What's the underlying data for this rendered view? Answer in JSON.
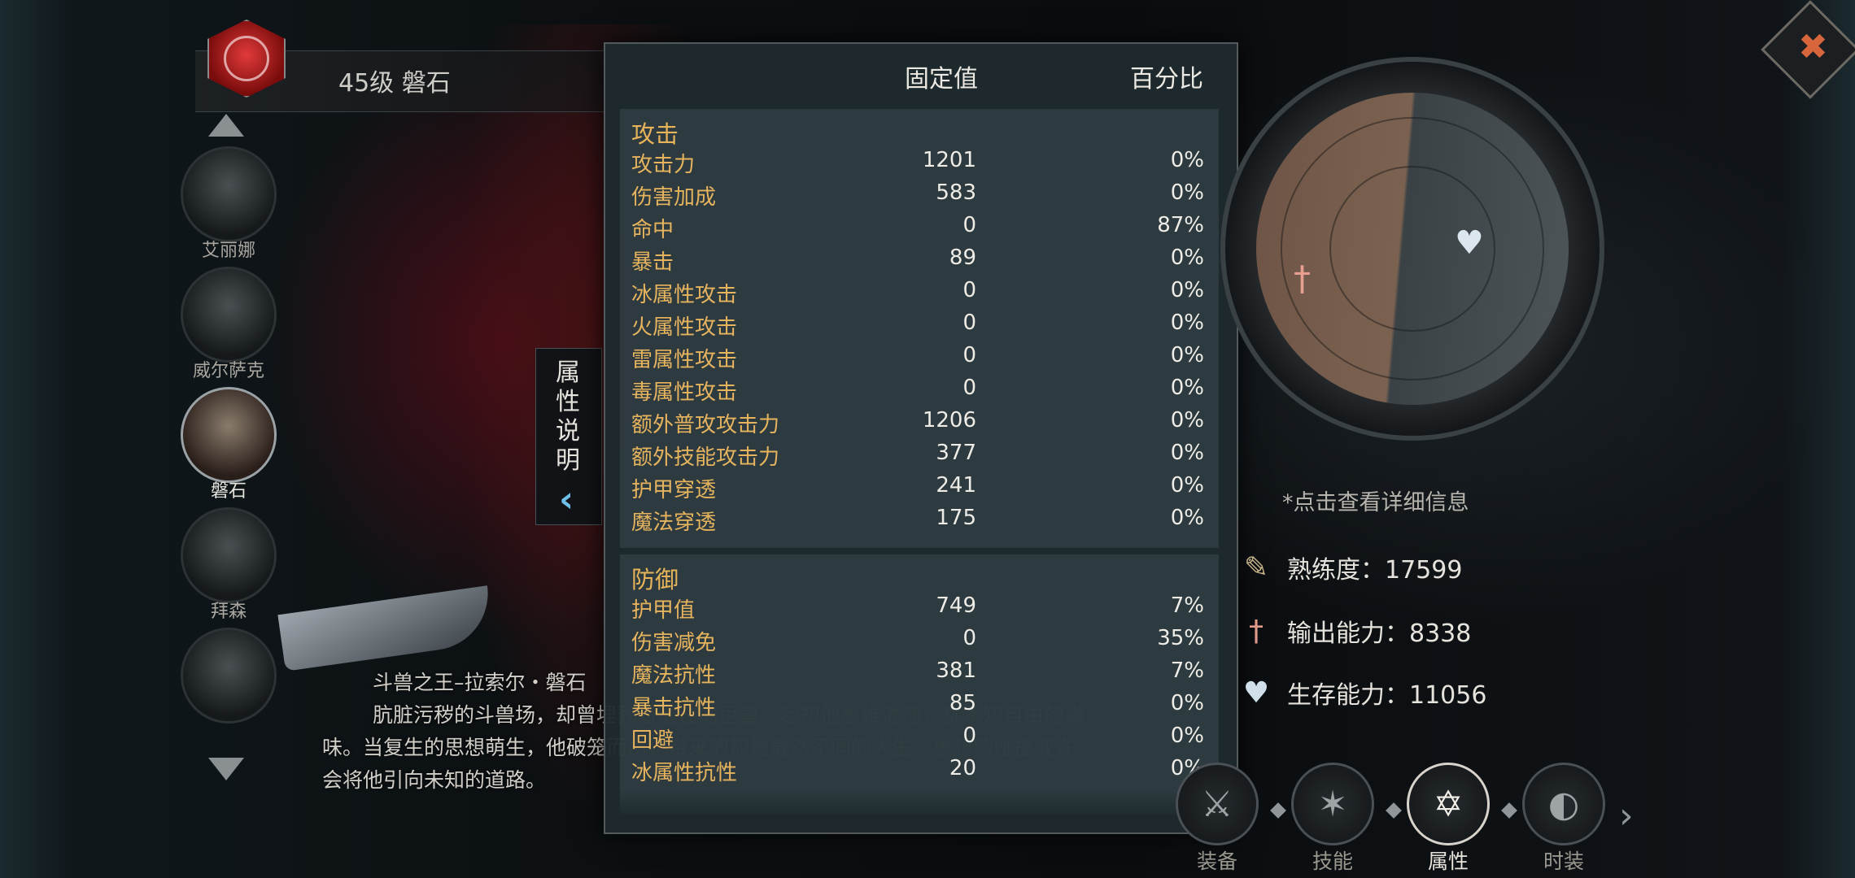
{
  "hero": {
    "title": "45级 磐石"
  },
  "heroes": [
    {
      "name": "艾丽娜"
    },
    {
      "name": "威尔萨克"
    },
    {
      "name": "磐石"
    },
    {
      "name": "拜森"
    },
    {
      "name": ""
    }
  ],
  "attr_tab": {
    "label": "属性说明"
  },
  "description": {
    "title": "斗兽之王–拉索尔・磐石",
    "body": "肮脏污秽的斗兽场，却曾埋葬着潜在的巨兽。起初他思维混沌，犹不知自由的滋味。当复生的思想萌生，他破笼而出，带来的却是截然不同的人生。思想的碰撞或许会将他引向未知的道路。"
  },
  "stats": {
    "col_fixed": "固定值",
    "col_pct": "百分比",
    "attack": {
      "title": "攻击",
      "rows": [
        {
          "name": "攻击力",
          "value": "1201",
          "pct": "0%"
        },
        {
          "name": "伤害加成",
          "value": "583",
          "pct": "0%"
        },
        {
          "name": "命中",
          "value": "0",
          "pct": "87%"
        },
        {
          "name": "暴击",
          "value": "89",
          "pct": "0%"
        },
        {
          "name": "冰属性攻击",
          "value": "0",
          "pct": "0%"
        },
        {
          "name": "火属性攻击",
          "value": "0",
          "pct": "0%"
        },
        {
          "name": "雷属性攻击",
          "value": "0",
          "pct": "0%"
        },
        {
          "name": "毒属性攻击",
          "value": "0",
          "pct": "0%"
        },
        {
          "name": "额外普攻攻击力",
          "value": "1206",
          "pct": "0%"
        },
        {
          "name": "额外技能攻击力",
          "value": "377",
          "pct": "0%"
        },
        {
          "name": "护甲穿透",
          "value": "241",
          "pct": "0%"
        },
        {
          "name": "魔法穿透",
          "value": "175",
          "pct": "0%"
        }
      ]
    },
    "defense": {
      "title": "防御",
      "rows": [
        {
          "name": "护甲值",
          "value": "749",
          "pct": "7%"
        },
        {
          "name": "伤害减免",
          "value": "0",
          "pct": "35%"
        },
        {
          "name": "魔法抗性",
          "value": "381",
          "pct": "7%"
        },
        {
          "name": "暴击抗性",
          "value": "85",
          "pct": "0%"
        },
        {
          "name": "回避",
          "value": "0",
          "pct": "0%"
        },
        {
          "name": "冰属性抗性",
          "value": "20",
          "pct": "0%"
        }
      ]
    }
  },
  "hint": "*点击查看详细信息",
  "metrics": [
    {
      "icon": "proficiency-icon",
      "label": "熟练度：17599"
    },
    {
      "icon": "output-icon",
      "label": "输出能力：8338"
    },
    {
      "icon": "survival-icon",
      "label": "生存能力：11056"
    }
  ],
  "nav": [
    {
      "label": "装备",
      "icon": "equipment-icon"
    },
    {
      "label": "技能",
      "icon": "skill-icon"
    },
    {
      "label": "属性",
      "icon": "attribute-icon",
      "active": true
    },
    {
      "label": "时装",
      "icon": "costume-icon"
    }
  ],
  "colors": {
    "accent_gold": "#e6b45e",
    "hint_blue": "#6fc0e8",
    "emblem_red": "#e23a3a"
  }
}
